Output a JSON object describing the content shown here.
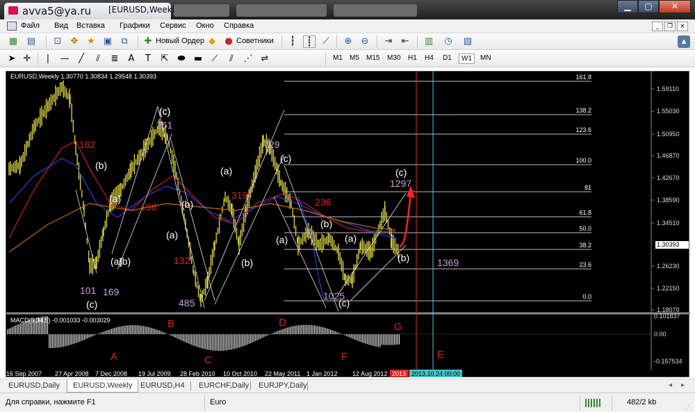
{
  "window": {
    "email": "avva5@ya.ru",
    "symbol": "[EURUSD,Weekly]",
    "controls": [
      "▁",
      "▢",
      "✕"
    ]
  },
  "menu": [
    "Файл",
    "Вид",
    "Вставка",
    "Графики",
    "Сервис",
    "Окно",
    "Справка"
  ],
  "toolbar": {
    "new_order": "Новый Ордер",
    "advisors": "Советники"
  },
  "timeframes": [
    "M1",
    "M5",
    "M15",
    "M30",
    "H1",
    "H4",
    "D1",
    "W1",
    "MN"
  ],
  "chart": {
    "header": "EURUSD,Weekly  1.30770 1.30834 1.29548 1.30393",
    "price_labels": [
      "1.59110",
      "1.55030",
      "1.50950",
      "1.46870",
      "1.42670",
      "1.38590",
      "1.34510",
      "1.30393",
      "1.26230",
      "1.22150",
      "1.18070"
    ],
    "current_price": "1.30393",
    "fib_levels": [
      "161.8",
      "138.2",
      "123.6",
      "100.0",
      "81",
      "61.8",
      "50.0",
      "38.2",
      "23.6",
      "0.0"
    ],
    "date_labels": [
      "16 Sep 2007",
      "27 Apr 2008",
      "7 Dec 2008",
      "19 Jul 2009",
      "28 Feb 2010",
      "10 Oct 2010",
      "22 May 2011",
      "1 Jan 2012",
      "12 Aug 2012"
    ],
    "date_red": "2013",
    "date_cyan": "2013.10.24 00:00",
    "wave_labels": [
      {
        "t": "(b)",
        "c": "#ffffff"
      },
      {
        "t": "(a)",
        "c": "#ffffff"
      },
      {
        "t": "(b)",
        "c": "#ffffff"
      },
      {
        "t": "(c)",
        "c": "#ffffff"
      },
      {
        "t": "(a)",
        "c": "#ffffff"
      },
      {
        "t": "(b)",
        "c": "#ffffff"
      },
      {
        "t": "(a)",
        "c": "#ffffff"
      },
      {
        "t": "(b)",
        "c": "#ffffff"
      },
      {
        "t": "(c)",
        "c": "#ffffff"
      },
      {
        "t": "(c)",
        "c": "#ffffff"
      },
      {
        "t": "(a)",
        "c": "#ffffff"
      },
      {
        "t": "(b)",
        "c": "#ffffff"
      },
      {
        "t": "(a)",
        "c": "#ffffff"
      },
      {
        "t": "(c)",
        "c": "#ffffff"
      },
      {
        "t": "(c)",
        "c": "#ffffff"
      },
      {
        "t": "(b)",
        "c": "#ffffff"
      },
      {
        "t": "(a)",
        "c": "#ffffff"
      },
      {
        "t": "(c)",
        "c": "#ffffff"
      },
      {
        "t": "101",
        "c": "#c8a0e0"
      },
      {
        "t": "169",
        "c": "#c8a0e0"
      },
      {
        "t": "361",
        "c": "#c8a0e0"
      },
      {
        "t": "485",
        "c": "#c8a0e0"
      },
      {
        "t": "729",
        "c": "#c8a0e0"
      },
      {
        "t": "1025",
        "c": "#c8a0e0"
      },
      {
        "t": "1297",
        "c": "#c8a0e0"
      },
      {
        "t": "1369",
        "c": "#c8a0e0"
      },
      {
        "t": "162",
        "c": "#e02020"
      },
      {
        "t": "196",
        "c": "#e02020"
      },
      {
        "t": "132",
        "c": "#e02020"
      },
      {
        "t": "319",
        "c": "#e02020"
      },
      {
        "t": "236",
        "c": "#e02020"
      }
    ],
    "macd_header": "MACD(5,34,5) -0.001033 -0.003029",
    "macd_labels": [
      "0.101837",
      "0.00",
      "-0.157534"
    ],
    "macd_letters": [
      "A",
      "B",
      "C",
      "D",
      "F",
      "G",
      "E"
    ]
  },
  "tabs": [
    "EURUSD,Daily",
    "EURUSD,Weekly",
    "EURUSD,H4",
    "EURCHF,Daily",
    "EURJPY,Daily"
  ],
  "active_tab": "EURUSD,Weekly",
  "status": {
    "help": "Для справки, нажмите F1",
    "symbol": "Euro",
    "traffic": "482/2 kb"
  }
}
